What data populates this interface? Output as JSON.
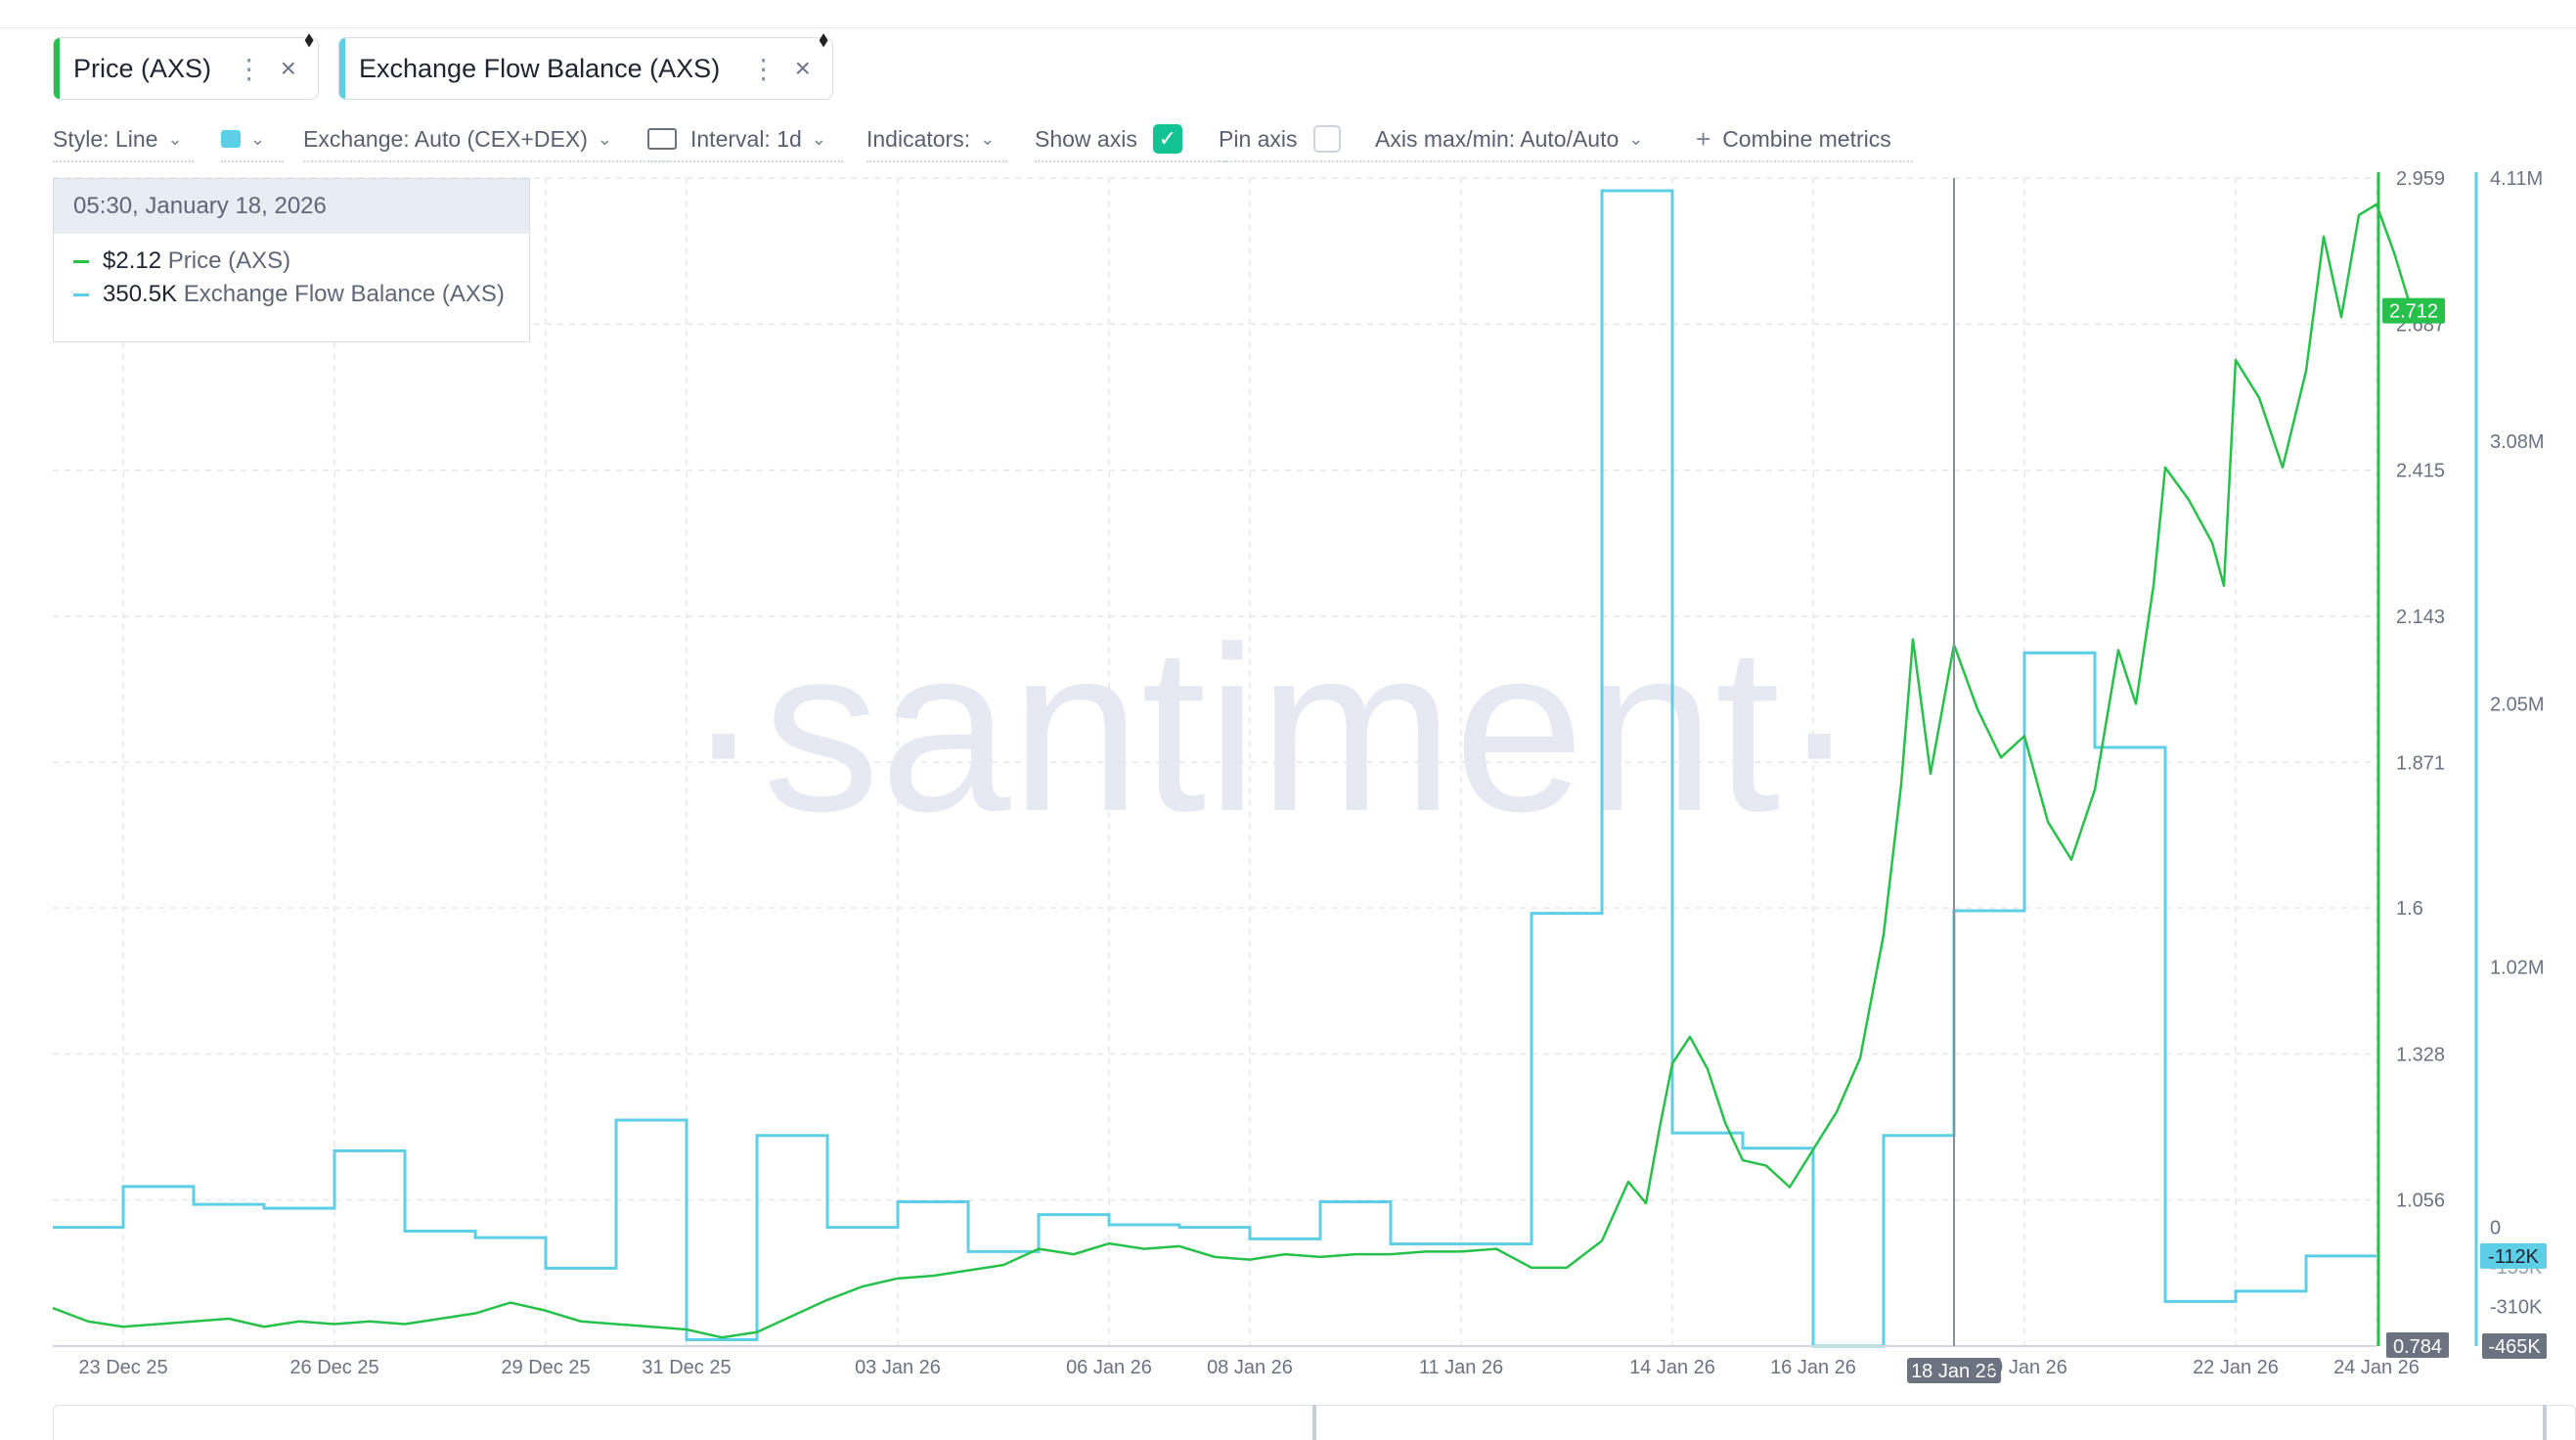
{
  "metrics": [
    {
      "label": "Price (AXS)",
      "color": "#26c04a"
    },
    {
      "label": "Exchange Flow Balance (AXS)",
      "color": "#5ccfe6"
    }
  ],
  "toolbar": {
    "style": "Style: Line",
    "exchange": "Exchange: Auto (CEX+DEX)",
    "interval": "Interval: 1d",
    "indicators": "Indicators:",
    "show_axis": "Show axis",
    "show_axis_checked": true,
    "pin_axis": "Pin axis",
    "pin_axis_checked": false,
    "axis_maxmin": "Axis max/min: Auto/Auto",
    "combine": "Combine metrics"
  },
  "tooltip": {
    "date": "05:30, January 18, 2026",
    "price_value": "$2.12",
    "price_label": "Price (AXS)",
    "flow_value": "350.5K",
    "flow_label": "Exchange Flow Balance (AXS)"
  },
  "watermark": "·santiment·",
  "chart_data": {
    "type": "line",
    "x_tick_labels": [
      "23 Dec 25",
      "26 Dec 25",
      "29 Dec 25",
      "31 Dec 25",
      "03 Jan 26",
      "06 Jan 26",
      "08 Jan 26",
      "11 Jan 26",
      "14 Jan 26",
      "16 Jan 26",
      "19 Jan 26",
      "22 Jan 26",
      "24 Jan 26"
    ],
    "x_tick_dates": [
      "2025-12-23",
      "2025-12-26",
      "2025-12-29",
      "2025-12-31",
      "2026-01-03",
      "2026-01-06",
      "2026-01-08",
      "2026-01-11",
      "2026-01-14",
      "2026-01-16",
      "2026-01-19",
      "2026-01-22",
      "2026-01-24"
    ],
    "x_range": [
      "2025-12-22",
      "2026-01-24"
    ],
    "crosshair_label": "18 Jan 26",
    "crosshair_date": "2026-01-18",
    "price_axis": {
      "ticks": [
        "2.959",
        "2.687",
        "2.415",
        "2.143",
        "1.871",
        "1.6",
        "1.328",
        "1.056",
        "0.784"
      ],
      "min": 0.784,
      "max": 2.959,
      "current": "2.712"
    },
    "flow_axis": {
      "ticks": [
        "4.11M",
        "3.08M",
        "2.05M",
        "1.02M",
        "0",
        "-310K",
        "-465K"
      ],
      "min": -465000,
      "max": 4110000,
      "current": "-112K",
      "hidden_tick": "-155K"
    },
    "grid": true,
    "series": [
      {
        "name": "Price (AXS)",
        "axis": "price",
        "color": "#26c04a",
        "points": [
          [
            "2025-12-22",
            0.855
          ],
          [
            "2025-12-22T12",
            0.83
          ],
          [
            "2025-12-23",
            0.82
          ],
          [
            "2025-12-23T12",
            0.825
          ],
          [
            "2025-12-24",
            0.83
          ],
          [
            "2025-12-24T12",
            0.835
          ],
          [
            "2025-12-25",
            0.82
          ],
          [
            "2025-12-25T12",
            0.83
          ],
          [
            "2025-12-26",
            0.825
          ],
          [
            "2025-12-26T12",
            0.83
          ],
          [
            "2025-12-27",
            0.825
          ],
          [
            "2025-12-27T12",
            0.835
          ],
          [
            "2025-12-28",
            0.845
          ],
          [
            "2025-12-28T12",
            0.865
          ],
          [
            "2025-12-29",
            0.85
          ],
          [
            "2025-12-29T12",
            0.83
          ],
          [
            "2025-12-30",
            0.825
          ],
          [
            "2025-12-30T12",
            0.82
          ],
          [
            "2025-12-31",
            0.815
          ],
          [
            "2025-12-31T12",
            0.8
          ],
          [
            "2026-01-01",
            0.81
          ],
          [
            "2026-01-01T12",
            0.84
          ],
          [
            "2026-01-02",
            0.87
          ],
          [
            "2026-01-02T12",
            0.895
          ],
          [
            "2026-01-03",
            0.91
          ],
          [
            "2026-01-03T12",
            0.915
          ],
          [
            "2026-01-04",
            0.925
          ],
          [
            "2026-01-04T12",
            0.935
          ],
          [
            "2026-01-05",
            0.965
          ],
          [
            "2026-01-05T12",
            0.955
          ],
          [
            "2026-01-06",
            0.975
          ],
          [
            "2026-01-06T12",
            0.965
          ],
          [
            "2026-01-07",
            0.97
          ],
          [
            "2026-01-07T12",
            0.95
          ],
          [
            "2026-01-08",
            0.945
          ],
          [
            "2026-01-08T12",
            0.955
          ],
          [
            "2026-01-09",
            0.95
          ],
          [
            "2026-01-09T12",
            0.955
          ],
          [
            "2026-01-10",
            0.955
          ],
          [
            "2026-01-10T12",
            0.96
          ],
          [
            "2026-01-11",
            0.96
          ],
          [
            "2026-01-11T12",
            0.965
          ],
          [
            "2026-01-12",
            0.93
          ],
          [
            "2026-01-12T12",
            0.93
          ],
          [
            "2026-01-13",
            0.98
          ],
          [
            "2026-01-13T09",
            1.09
          ],
          [
            "2026-01-13T15",
            1.05
          ],
          [
            "2026-01-13T20",
            1.2
          ],
          [
            "2026-01-14",
            1.31
          ],
          [
            "2026-01-14T06",
            1.36
          ],
          [
            "2026-01-14T12",
            1.3
          ],
          [
            "2026-01-14T18",
            1.2
          ],
          [
            "2026-01-15",
            1.13
          ],
          [
            "2026-01-15T08",
            1.12
          ],
          [
            "2026-01-15T16",
            1.08
          ],
          [
            "2026-01-16",
            1.15
          ],
          [
            "2026-01-16T08",
            1.22
          ],
          [
            "2026-01-16T16",
            1.32
          ],
          [
            "2026-01-17",
            1.55
          ],
          [
            "2026-01-17T06",
            1.83
          ],
          [
            "2026-01-17T10",
            2.1
          ],
          [
            "2026-01-17T16",
            1.85
          ],
          [
            "2026-01-18",
            2.09
          ],
          [
            "2026-01-18T08",
            1.97
          ],
          [
            "2026-01-18T16",
            1.88
          ],
          [
            "2026-01-19",
            1.92
          ],
          [
            "2026-01-19T08",
            1.76
          ],
          [
            "2026-01-19T16",
            1.69
          ],
          [
            "2026-01-20",
            1.82
          ],
          [
            "2026-01-20T08",
            2.08
          ],
          [
            "2026-01-20T14",
            1.98
          ],
          [
            "2026-01-20T20",
            2.2
          ],
          [
            "2026-01-21",
            2.42
          ],
          [
            "2026-01-21T08",
            2.36
          ],
          [
            "2026-01-21T16",
            2.28
          ],
          [
            "2026-01-21T20",
            2.2
          ],
          [
            "2026-01-22",
            2.62
          ],
          [
            "2026-01-22T08",
            2.55
          ],
          [
            "2026-01-22T16",
            2.42
          ],
          [
            "2026-01-23",
            2.6
          ],
          [
            "2026-01-23T06",
            2.85
          ],
          [
            "2026-01-23T12",
            2.7
          ],
          [
            "2026-01-23T18",
            2.89
          ],
          [
            "2026-01-24",
            2.91
          ],
          [
            "2026-01-24T06",
            2.82
          ],
          [
            "2026-01-24T12",
            2.712
          ]
        ]
      },
      {
        "name": "Exchange Flow Balance (AXS)",
        "axis": "flow",
        "color": "#5ccfe6",
        "points": [
          [
            "2025-12-22",
            0
          ],
          [
            "2025-12-23",
            160000
          ],
          [
            "2025-12-24",
            90000
          ],
          [
            "2025-12-25",
            75000
          ],
          [
            "2025-12-26",
            300000
          ],
          [
            "2025-12-27",
            -15000
          ],
          [
            "2025-12-28",
            -40000
          ],
          [
            "2025-12-29",
            -160000
          ],
          [
            "2025-12-30",
            420000
          ],
          [
            "2025-12-31",
            -440000
          ],
          [
            "2026-01-01",
            360000
          ],
          [
            "2026-01-02",
            0
          ],
          [
            "2026-01-03",
            100000
          ],
          [
            "2026-01-04",
            -95000
          ],
          [
            "2026-01-05",
            50000
          ],
          [
            "2026-01-06",
            10000
          ],
          [
            "2026-01-07",
            0
          ],
          [
            "2026-01-08",
            -45000
          ],
          [
            "2026-01-09",
            100000
          ],
          [
            "2026-01-10",
            -65000
          ],
          [
            "2026-01-11",
            -65000
          ],
          [
            "2026-01-12",
            1230000
          ],
          [
            "2026-01-13",
            4060000
          ],
          [
            "2026-01-14",
            370000
          ],
          [
            "2026-01-15",
            310000
          ],
          [
            "2026-01-16",
            -465000
          ],
          [
            "2026-01-17",
            360000
          ],
          [
            "2026-01-18",
            1240000
          ],
          [
            "2026-01-19",
            2250000
          ],
          [
            "2026-01-20",
            1880000
          ],
          [
            "2026-01-21",
            -290000
          ],
          [
            "2026-01-22",
            -250000
          ],
          [
            "2026-01-23",
            -112000
          ],
          [
            "2026-01-24",
            -112000
          ]
        ]
      }
    ]
  }
}
